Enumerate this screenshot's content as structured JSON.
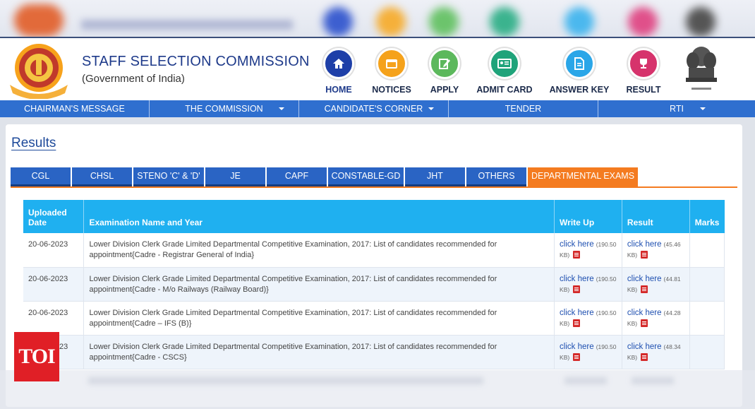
{
  "org": {
    "title": "STAFF SELECTION COMMISSION",
    "subtitle": "(Government of India)"
  },
  "nav_icons": [
    {
      "label": "HOME",
      "icon": "home-icon",
      "color": "#1e3fa8"
    },
    {
      "label": "NOTICES",
      "icon": "notices-icon",
      "color": "#f5a21b"
    },
    {
      "label": "APPLY",
      "icon": "apply-icon",
      "color": "#5cb85c"
    },
    {
      "label": "ADMIT CARD",
      "icon": "admit-card-icon",
      "color": "#1fa37a"
    },
    {
      "label": "ANSWER KEY",
      "icon": "answer-key-icon",
      "color": "#2aa6e8"
    },
    {
      "label": "RESULT",
      "icon": "trophy-icon",
      "color": "#d6336c"
    }
  ],
  "menu": [
    {
      "label": "CHAIRMAN'S MESSAGE",
      "dropdown": false
    },
    {
      "label": "THE COMMISSION",
      "dropdown": true
    },
    {
      "label": "CANDIDATE'S CORNER",
      "dropdown": true
    },
    {
      "label": "TENDER",
      "dropdown": false
    },
    {
      "label": "RTI",
      "dropdown": true
    }
  ],
  "page_title": "Results",
  "tabs": [
    "CGL",
    "CHSL",
    "STENO 'C' & 'D'",
    "JE",
    "CAPF",
    "CONSTABLE-GD",
    "JHT",
    "OTHERS",
    "DEPARTMENTAL EXAMS"
  ],
  "active_tab": "DEPARTMENTAL EXAMS",
  "table": {
    "headers": {
      "date_1": "Uploaded",
      "date_2": "Date",
      "exam": "Examination Name and Year",
      "writeup": "Write Up",
      "result": "Result",
      "marks": "Marks"
    },
    "rows": [
      {
        "date": "20-06-2023",
        "exam_line1": "Lower Division Clerk Grade Limited Departmental Competitive Examination, 2017: List of candidates recommended for",
        "exam_line2": "appointment{Cadre - Registrar General of India}",
        "writeup_link": "click here",
        "writeup_size_a": "(190.50",
        "writeup_size_b": "KB)",
        "result_link": "click here",
        "result_size_a": "(45.46",
        "result_size_b": "KB)"
      },
      {
        "date": "20-06-2023",
        "exam_line1": "Lower Division Clerk Grade Limited Departmental Competitive Examination, 2017: List of candidates recommended for",
        "exam_line2": "appointment{Cadre - M/o Railways (Railway Board)}",
        "writeup_link": "click here",
        "writeup_size_a": "(190.50",
        "writeup_size_b": "KB)",
        "result_link": "click here",
        "result_size_a": "(44.81",
        "result_size_b": "KB)"
      },
      {
        "date": "20-06-2023",
        "exam_line1": "Lower Division Clerk Grade Limited Departmental Competitive Examination, 2017: List of candidates recommended for",
        "exam_line2": "appointment{Cadre – IFS (B)}",
        "writeup_link": "click here",
        "writeup_size_a": "(190.50",
        "writeup_size_b": "KB)",
        "result_link": "click here",
        "result_size_a": "(44.28",
        "result_size_b": "KB)"
      },
      {
        "date": "20-06-2023",
        "exam_line1": "Lower Division Clerk Grade Limited Departmental Competitive Examination, 2017: List of candidates recommended for",
        "exam_line2": "appointment{Cadre - CSCS}",
        "writeup_link": "click here",
        "writeup_size_a": "(190.50",
        "writeup_size_b": "KB)",
        "result_link": "click here",
        "result_size_a": "(48.34",
        "result_size_b": "KB)"
      }
    ]
  },
  "watermark": "TOI",
  "colors": {
    "menu_bar": "#2f6fcf",
    "tab": "#2a64c4",
    "tab_active": "#f47b20",
    "table_header": "#1fb0f0",
    "title": "#1e3a8a"
  }
}
